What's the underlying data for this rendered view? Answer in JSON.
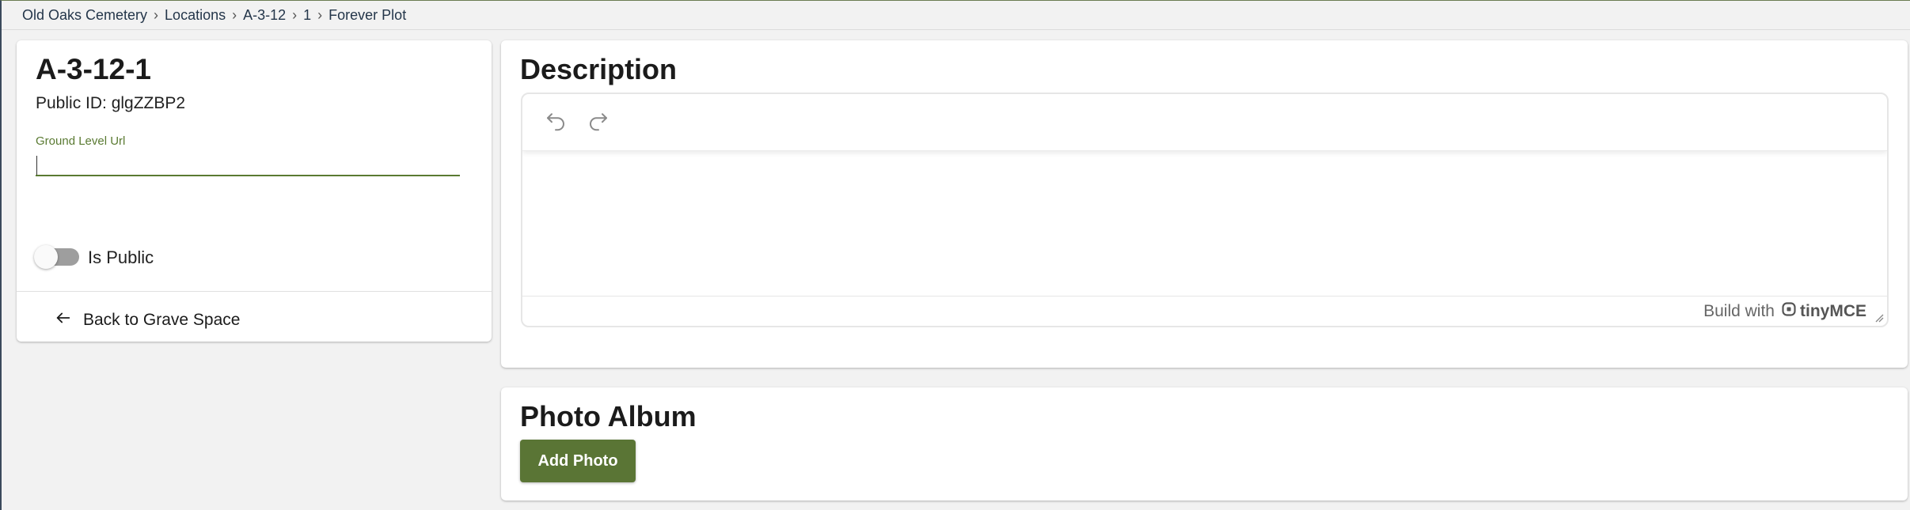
{
  "breadcrumb": {
    "items": [
      "Old Oaks Cemetery",
      "Locations",
      "A-3-12",
      "1",
      "Forever Plot"
    ],
    "separator": "›"
  },
  "plot": {
    "title": "A-3-12-1",
    "public_id_text": "Public ID: glgZZBP2"
  },
  "ground_level_url": {
    "label": "Ground Level Url",
    "value": ""
  },
  "is_public": {
    "label": "Is Public",
    "checked": false
  },
  "back_link": {
    "label": "Back to Grave Space"
  },
  "description": {
    "title": "Description",
    "content": "",
    "branding_prefix": "Build with",
    "branding_name": "tinyMCE"
  },
  "photo_album": {
    "title": "Photo Album",
    "add_button_label": "Add Photo"
  },
  "colors": {
    "accent_green": "#5a7535",
    "field_green": "#5a7a32",
    "background": "#f2f2f2"
  },
  "icons": {
    "back": "arrow-left-icon",
    "undo": "undo-icon",
    "redo": "redo-icon",
    "brand": "tinymce-logo-icon"
  }
}
